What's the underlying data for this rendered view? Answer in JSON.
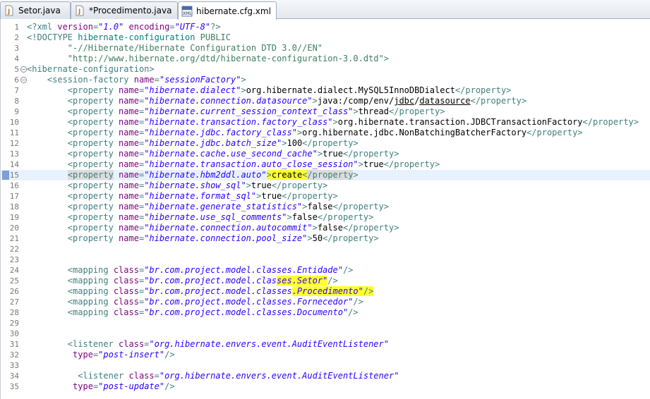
{
  "tabs": [
    {
      "label": "Setor.java",
      "icon": "java-file-icon",
      "active": false
    },
    {
      "label": "*Procedimento.java",
      "icon": "java-file-icon",
      "active": false
    },
    {
      "label": "hibernate.cfg.xml",
      "icon": "xml-file-icon",
      "active": true,
      "close": "⊠"
    }
  ],
  "lines": [
    {
      "n": "1",
      "parts": [
        [
          "t",
          "<?xml "
        ],
        [
          "a",
          "version"
        ],
        [
          "t",
          "="
        ],
        [
          "v",
          "\"1.0\""
        ],
        [
          "t",
          " "
        ],
        [
          "a",
          "encoding"
        ],
        [
          "t",
          "="
        ],
        [
          "v",
          "\"UTF-8\""
        ],
        [
          "t",
          "?>"
        ]
      ]
    },
    {
      "n": "2",
      "parts": [
        [
          "t",
          "<!DOCTYPE "
        ],
        [
          "d",
          "hibernate-configuration "
        ],
        [
          "dp",
          "PUBLIC"
        ]
      ]
    },
    {
      "n": "3",
      "parts": [
        [
          "x",
          "        "
        ],
        [
          "dp",
          "\"-//Hibernate/Hibernate Configuration DTD 3.0//EN\""
        ]
      ]
    },
    {
      "n": "4",
      "parts": [
        [
          "x",
          "        "
        ],
        [
          "dp",
          "\"http://www.hibernate.org/dtd/hibernate-configuration-3.0.dtd\""
        ],
        [
          "t",
          ">"
        ]
      ]
    },
    {
      "n": "5",
      "fold": "−",
      "parts": [
        [
          "t",
          "<hibernate-configuration>"
        ]
      ]
    },
    {
      "n": "6",
      "fold": "−",
      "parts": [
        [
          "x",
          "    "
        ],
        [
          "t",
          "<session-factory "
        ],
        [
          "a",
          "name"
        ],
        [
          "t",
          "="
        ],
        [
          "v",
          "\"sessionFactory\""
        ],
        [
          "t",
          ">"
        ]
      ]
    },
    {
      "n": "7",
      "parts": [
        [
          "x",
          "        "
        ],
        [
          "t",
          "<property "
        ],
        [
          "a",
          "name"
        ],
        [
          "t",
          "="
        ],
        [
          "v",
          "\"hibernate.dialect\""
        ],
        [
          "t",
          ">"
        ],
        [
          "x",
          "org.hibernate.dialect.MySQL5InnoDBDialect"
        ],
        [
          "t",
          "</property>"
        ]
      ]
    },
    {
      "n": "8",
      "parts": [
        [
          "x",
          "        "
        ],
        [
          "t",
          "<property "
        ],
        [
          "a",
          "name"
        ],
        [
          "t",
          "="
        ],
        [
          "v",
          "\"hibernate.connection.datasource\""
        ],
        [
          "t",
          ">"
        ],
        [
          "x",
          "java:/comp/env/"
        ],
        [
          "xu",
          "jdbc"
        ],
        [
          "x",
          "/"
        ],
        [
          "xu",
          "datasource"
        ],
        [
          "t",
          "</property>"
        ]
      ]
    },
    {
      "n": "9",
      "parts": [
        [
          "x",
          "        "
        ],
        [
          "t",
          "<property "
        ],
        [
          "a",
          "name"
        ],
        [
          "t",
          "="
        ],
        [
          "v",
          "\"hibernate.current_session_context_class\""
        ],
        [
          "t",
          ">"
        ],
        [
          "x",
          "thread"
        ],
        [
          "t",
          "</property>"
        ]
      ]
    },
    {
      "n": "10",
      "parts": [
        [
          "x",
          "        "
        ],
        [
          "t",
          "<property "
        ],
        [
          "a",
          "name"
        ],
        [
          "t",
          "="
        ],
        [
          "v",
          "\"hibernate.transaction.factory_class\""
        ],
        [
          "t",
          ">"
        ],
        [
          "x",
          "org.hibernate.transaction.JDBCTransactionFactory"
        ],
        [
          "t",
          "</property>"
        ]
      ]
    },
    {
      "n": "11",
      "parts": [
        [
          "x",
          "        "
        ],
        [
          "t",
          "<property "
        ],
        [
          "a",
          "name"
        ],
        [
          "t",
          "="
        ],
        [
          "v",
          "\"hibernate.jdbc.factory_class\""
        ],
        [
          "t",
          ">"
        ],
        [
          "x",
          "org.hibernate.jdbc.NonBatchingBatcherFactory"
        ],
        [
          "t",
          "</property>"
        ]
      ]
    },
    {
      "n": "12",
      "parts": [
        [
          "x",
          "        "
        ],
        [
          "t",
          "<property "
        ],
        [
          "a",
          "name"
        ],
        [
          "t",
          "="
        ],
        [
          "v",
          "\"hibernate.jdbc.batch_size\""
        ],
        [
          "t",
          ">"
        ],
        [
          "x",
          "100"
        ],
        [
          "t",
          "</property>"
        ]
      ]
    },
    {
      "n": "13",
      "parts": [
        [
          "x",
          "        "
        ],
        [
          "t",
          "<property "
        ],
        [
          "a",
          "name"
        ],
        [
          "t",
          "="
        ],
        [
          "v",
          "\"hibernate.cache.use_second_cache\""
        ],
        [
          "t",
          ">"
        ],
        [
          "x",
          "true"
        ],
        [
          "t",
          "</property>"
        ]
      ]
    },
    {
      "n": "14",
      "parts": [
        [
          "x",
          "        "
        ],
        [
          "t",
          "<property "
        ],
        [
          "a",
          "name"
        ],
        [
          "t",
          "="
        ],
        [
          "v",
          "\"hibernate.transaction.auto_close_session\""
        ],
        [
          "t",
          ">"
        ],
        [
          "x",
          "true"
        ],
        [
          "t",
          "</property>"
        ]
      ]
    },
    {
      "n": "15",
      "current": true,
      "marker": true,
      "parts": [
        [
          "x",
          "        "
        ],
        [
          "th",
          "<property"
        ],
        [
          "t",
          " "
        ],
        [
          "a",
          "name"
        ],
        [
          "t",
          "="
        ],
        [
          "v",
          "\"hibernate.hbm2ddl.auto\""
        ],
        [
          "tY",
          ">"
        ],
        [
          "xY",
          "create"
        ],
        [
          "tY",
          "<"
        ],
        [
          "th",
          "/property"
        ],
        [
          "t",
          ">"
        ]
      ]
    },
    {
      "n": "16",
      "parts": [
        [
          "x",
          "        "
        ],
        [
          "t",
          "<property "
        ],
        [
          "a",
          "name"
        ],
        [
          "t",
          "="
        ],
        [
          "v",
          "\"hibernate.show_sql\""
        ],
        [
          "t",
          ">"
        ],
        [
          "x",
          "true"
        ],
        [
          "t",
          "</property>"
        ]
      ]
    },
    {
      "n": "17",
      "parts": [
        [
          "x",
          "        "
        ],
        [
          "t",
          "<property "
        ],
        [
          "a",
          "name"
        ],
        [
          "t",
          "="
        ],
        [
          "v",
          "\"hibernate.format_sql\""
        ],
        [
          "t",
          ">"
        ],
        [
          "x",
          "true"
        ],
        [
          "t",
          "</property>"
        ]
      ]
    },
    {
      "n": "18",
      "parts": [
        [
          "x",
          "        "
        ],
        [
          "t",
          "<property "
        ],
        [
          "a",
          "name"
        ],
        [
          "t",
          "="
        ],
        [
          "v",
          "\"hibernate.generate_statistics\""
        ],
        [
          "t",
          ">"
        ],
        [
          "x",
          "false"
        ],
        [
          "t",
          "</property>"
        ]
      ]
    },
    {
      "n": "19",
      "parts": [
        [
          "x",
          "        "
        ],
        [
          "t",
          "<property "
        ],
        [
          "a",
          "name"
        ],
        [
          "t",
          "="
        ],
        [
          "v",
          "\"hibernate.use_sql_comments\""
        ],
        [
          "t",
          ">"
        ],
        [
          "x",
          "false"
        ],
        [
          "t",
          "</property>"
        ]
      ]
    },
    {
      "n": "20",
      "parts": [
        [
          "x",
          "        "
        ],
        [
          "t",
          "<property "
        ],
        [
          "a",
          "name"
        ],
        [
          "t",
          "="
        ],
        [
          "v",
          "\"hibernate.connection.autocommit\""
        ],
        [
          "t",
          ">"
        ],
        [
          "x",
          "false"
        ],
        [
          "t",
          "</property>"
        ]
      ]
    },
    {
      "n": "21",
      "parts": [
        [
          "x",
          "        "
        ],
        [
          "t",
          "<property "
        ],
        [
          "a",
          "name"
        ],
        [
          "t",
          "="
        ],
        [
          "v",
          "\"hibernate.connection.pool_size\""
        ],
        [
          "t",
          ">"
        ],
        [
          "x",
          "50"
        ],
        [
          "t",
          "</property>"
        ]
      ]
    },
    {
      "n": "22",
      "parts": []
    },
    {
      "n": "23",
      "parts": []
    },
    {
      "n": "24",
      "parts": [
        [
          "x",
          "        "
        ],
        [
          "t",
          "<mapping "
        ],
        [
          "a",
          "class"
        ],
        [
          "t",
          "="
        ],
        [
          "v",
          "\"br.com.project.model.classes.Entidade\""
        ],
        [
          "t",
          "/>"
        ]
      ]
    },
    {
      "n": "25",
      "parts": [
        [
          "x",
          "        "
        ],
        [
          "t",
          "<mapping "
        ],
        [
          "a",
          "class"
        ],
        [
          "t",
          "="
        ],
        [
          "v",
          "\"br.com.project.model.clas"
        ],
        [
          "vY",
          "ses.Setor\""
        ],
        [
          "t",
          "/>"
        ]
      ]
    },
    {
      "n": "26",
      "parts": [
        [
          "x",
          "        "
        ],
        [
          "t",
          "<mapping "
        ],
        [
          "a",
          "class"
        ],
        [
          "t",
          "="
        ],
        [
          "v",
          "\"br.com.project.model.classes"
        ],
        [
          "vY",
          ".Procedimento\""
        ],
        [
          "tY",
          "/>"
        ]
      ]
    },
    {
      "n": "27",
      "parts": [
        [
          "x",
          "        "
        ],
        [
          "t",
          "<mapping "
        ],
        [
          "a",
          "class"
        ],
        [
          "t",
          "="
        ],
        [
          "v",
          "\"br.com.project.model.classes.Fornecedor\""
        ],
        [
          "t",
          "/>"
        ]
      ]
    },
    {
      "n": "28",
      "parts": [
        [
          "x",
          "        "
        ],
        [
          "t",
          "<mapping "
        ],
        [
          "a",
          "class"
        ],
        [
          "t",
          "="
        ],
        [
          "v",
          "\"br.com.project.model.classes.Documento\""
        ],
        [
          "t",
          "/>"
        ]
      ]
    },
    {
      "n": "29",
      "parts": []
    },
    {
      "n": "30",
      "parts": []
    },
    {
      "n": "31",
      "parts": [
        [
          "x",
          "        "
        ],
        [
          "t",
          "<listener "
        ],
        [
          "a",
          "class"
        ],
        [
          "t",
          "="
        ],
        [
          "v",
          "\"org.hibernate.envers.event.AuditEventListener\""
        ]
      ]
    },
    {
      "n": "32",
      "parts": [
        [
          "x",
          "         "
        ],
        [
          "a",
          "type"
        ],
        [
          "t",
          "="
        ],
        [
          "v",
          "\"post-insert\""
        ],
        [
          "t",
          "/>"
        ]
      ]
    },
    {
      "n": "33",
      "parts": []
    },
    {
      "n": "34",
      "parts": [
        [
          "x",
          "          "
        ],
        [
          "t",
          "<listener "
        ],
        [
          "a",
          "class"
        ],
        [
          "t",
          "="
        ],
        [
          "v",
          "\"org.hibernate.envers.event.AuditEventListener\""
        ]
      ]
    },
    {
      "n": "35",
      "parts": [
        [
          "x",
          "         "
        ],
        [
          "a",
          "type"
        ],
        [
          "t",
          "="
        ],
        [
          "v",
          "\"post-update\""
        ],
        [
          "t",
          "/>"
        ]
      ]
    }
  ]
}
